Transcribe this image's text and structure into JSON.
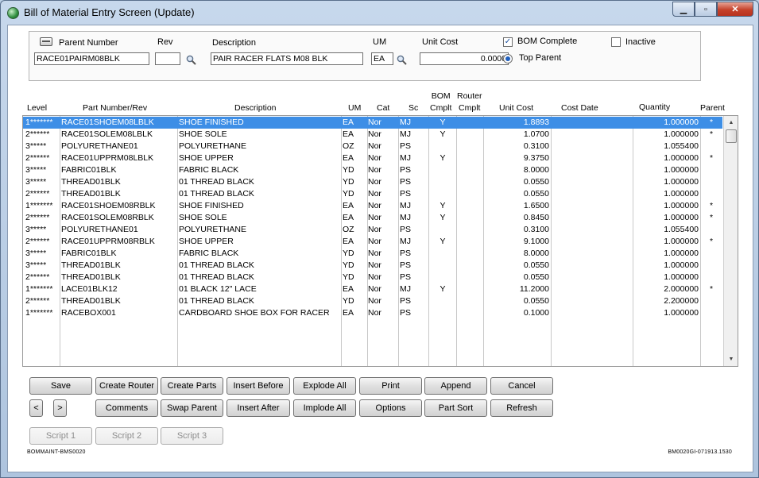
{
  "window": {
    "title": "Bill of Material Entry Screen (Update)",
    "min_glyph": "▁",
    "max_glyph": "▫",
    "close_glyph": "✕"
  },
  "header": {
    "parent_number_label": "Parent Number",
    "parent_number_value": "RACE01PAIRM08BLK",
    "rev_label": "Rev",
    "rev_value": "",
    "description_label": "Description",
    "description_value": "PAIR RACER FLATS M08 BLK",
    "um_label": "UM",
    "um_value": "EA",
    "unit_cost_label": "Unit Cost",
    "unit_cost_value": "0.0000",
    "bom_complete_label": "BOM Complete",
    "bom_complete_checked": true,
    "top_parent_label": "Top Parent",
    "inactive_label": "Inactive",
    "check_glyph": "✓"
  },
  "grid": {
    "columns": {
      "level": "Level",
      "part": "Part Number/Rev",
      "desc": "Description",
      "um": "UM",
      "cat": "Cat",
      "sc": "Sc",
      "bom1": "BOM",
      "bom2": "Cmplt",
      "router1": "Router",
      "router2": "Cmplt",
      "cost": "Unit Cost",
      "costdate": "Cost Date",
      "qty": "Quantity",
      "parent": "Parent"
    },
    "rows": [
      {
        "level": "1*******",
        "part": "RACE01SHOEM08LBLK",
        "desc": "SHOE FINISHED",
        "um": "EA",
        "cat": "Nor",
        "sc": "MJ",
        "bom": "Y",
        "router": "",
        "cost": "1.8893",
        "costdate": "",
        "qty": "1.000000",
        "parent": "*"
      },
      {
        "level": "2******",
        "part": "RACE01SOLEM08LBLK",
        "desc": "SHOE SOLE",
        "um": "EA",
        "cat": "Nor",
        "sc": "MJ",
        "bom": "Y",
        "router": "",
        "cost": "1.0700",
        "costdate": "",
        "qty": "1.000000",
        "parent": "*"
      },
      {
        "level": "3*****",
        "part": "POLYURETHANE01",
        "desc": "POLYURETHANE",
        "um": "OZ",
        "cat": "Nor",
        "sc": "PS",
        "bom": "",
        "router": "",
        "cost": "0.3100",
        "costdate": "",
        "qty": "1.055400",
        "parent": ""
      },
      {
        "level": "2******",
        "part": "RACE01UPPRM08LBLK",
        "desc": "SHOE UPPER",
        "um": "EA",
        "cat": "Nor",
        "sc": "MJ",
        "bom": "Y",
        "router": "",
        "cost": "9.3750",
        "costdate": "",
        "qty": "1.000000",
        "parent": "*"
      },
      {
        "level": "3*****",
        "part": "FABRIC01BLK",
        "desc": "FABRIC BLACK",
        "um": "YD",
        "cat": "Nor",
        "sc": "PS",
        "bom": "",
        "router": "",
        "cost": "8.0000",
        "costdate": "",
        "qty": "1.000000",
        "parent": ""
      },
      {
        "level": "3*****",
        "part": "THREAD01BLK",
        "desc": "01 THREAD BLACK",
        "um": "YD",
        "cat": "Nor",
        "sc": "PS",
        "bom": "",
        "router": "",
        "cost": "0.0550",
        "costdate": "",
        "qty": "1.000000",
        "parent": ""
      },
      {
        "level": "2******",
        "part": "THREAD01BLK",
        "desc": "01 THREAD BLACK",
        "um": "YD",
        "cat": "Nor",
        "sc": "PS",
        "bom": "",
        "router": "",
        "cost": "0.0550",
        "costdate": "",
        "qty": "1.000000",
        "parent": ""
      },
      {
        "level": "1*******",
        "part": "RACE01SHOEM08RBLK",
        "desc": "SHOE FINISHED",
        "um": "EA",
        "cat": "Nor",
        "sc": "MJ",
        "bom": "Y",
        "router": "",
        "cost": "1.6500",
        "costdate": "",
        "qty": "1.000000",
        "parent": "*"
      },
      {
        "level": "2******",
        "part": "RACE01SOLEM08RBLK",
        "desc": "SHOE SOLE",
        "um": "EA",
        "cat": "Nor",
        "sc": "MJ",
        "bom": "Y",
        "router": "",
        "cost": "0.8450",
        "costdate": "",
        "qty": "1.000000",
        "parent": "*"
      },
      {
        "level": "3*****",
        "part": "POLYURETHANE01",
        "desc": "POLYURETHANE",
        "um": "OZ",
        "cat": "Nor",
        "sc": "PS",
        "bom": "",
        "router": "",
        "cost": "0.3100",
        "costdate": "",
        "qty": "1.055400",
        "parent": ""
      },
      {
        "level": "2******",
        "part": "RACE01UPPRM08RBLK",
        "desc": "SHOE UPPER",
        "um": "EA",
        "cat": "Nor",
        "sc": "MJ",
        "bom": "Y",
        "router": "",
        "cost": "9.1000",
        "costdate": "",
        "qty": "1.000000",
        "parent": "*"
      },
      {
        "level": "3*****",
        "part": "FABRIC01BLK",
        "desc": "FABRIC BLACK",
        "um": "YD",
        "cat": "Nor",
        "sc": "PS",
        "bom": "",
        "router": "",
        "cost": "8.0000",
        "costdate": "",
        "qty": "1.000000",
        "parent": ""
      },
      {
        "level": "3*****",
        "part": "THREAD01BLK",
        "desc": "01 THREAD BLACK",
        "um": "YD",
        "cat": "Nor",
        "sc": "PS",
        "bom": "",
        "router": "",
        "cost": "0.0550",
        "costdate": "",
        "qty": "1.000000",
        "parent": ""
      },
      {
        "level": "2******",
        "part": "THREAD01BLK",
        "desc": "01 THREAD BLACK",
        "um": "YD",
        "cat": "Nor",
        "sc": "PS",
        "bom": "",
        "router": "",
        "cost": "0.0550",
        "costdate": "",
        "qty": "1.000000",
        "parent": ""
      },
      {
        "level": "1*******",
        "part": "LACE01BLK12",
        "desc": "01 BLACK 12\" LACE",
        "um": "EA",
        "cat": "Nor",
        "sc": "MJ",
        "bom": "Y",
        "router": "",
        "cost": "11.2000",
        "costdate": "",
        "qty": "2.000000",
        "parent": "*"
      },
      {
        "level": "2******",
        "part": "THREAD01BLK",
        "desc": "01 THREAD BLACK",
        "um": "YD",
        "cat": "Nor",
        "sc": "PS",
        "bom": "",
        "router": "",
        "cost": "0.0550",
        "costdate": "",
        "qty": "2.200000",
        "parent": ""
      },
      {
        "level": "1*******",
        "part": "RACEBOX001",
        "desc": "CARDBOARD SHOE BOX FOR RACER",
        "um": "EA",
        "cat": "Nor",
        "sc": "PS",
        "bom": "",
        "router": "",
        "cost": "0.1000",
        "costdate": "",
        "qty": "1.000000",
        "parent": ""
      }
    ],
    "scroll_up_glyph": "▲",
    "scroll_down_glyph": "▼"
  },
  "buttons": {
    "save": "Save",
    "create_router": "Create Router",
    "create_parts": "Create Parts",
    "insert_before": "Insert Before",
    "explode_all": "Explode All",
    "print": "Print",
    "append": "Append",
    "cancel": "Cancel",
    "prev": "<",
    "next": ">",
    "comments": "Comments",
    "swap_parent": "Swap Parent",
    "insert_after": "Insert After",
    "implode_all": "Implode All",
    "options": "Options",
    "part_sort": "Part Sort",
    "refresh": "Refresh",
    "script1": "Script 1",
    "script2": "Script 2",
    "script3": "Script 3"
  },
  "footer": {
    "left": "BOMMAINT-BMS0020",
    "right": "BM0020GI-071913.1530"
  },
  "colors": {
    "selection": "#3d8ee6",
    "title_gradient_top": "#c7d8ec",
    "close_button": "#c5412a"
  }
}
